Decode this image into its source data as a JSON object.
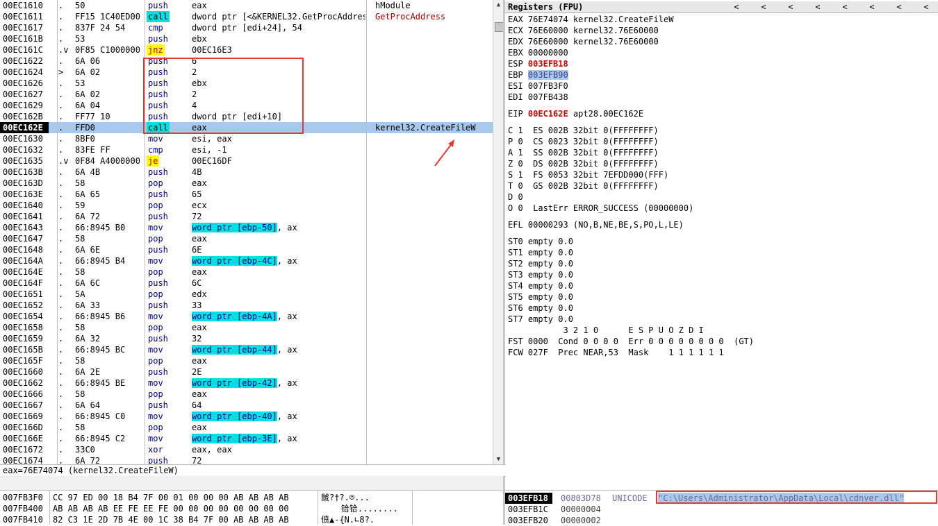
{
  "disasm": {
    "rows": [
      {
        "addr": "00EC1610",
        "mark": ".",
        "bytes": "50",
        "mn": "push",
        "op": "eax",
        "cm": "hModule"
      },
      {
        "addr": "00EC1611",
        "mark": ".",
        "bytes": "FF15 1C40ED00",
        "mn": "call",
        "op": "dword ptr [<&KERNEL32.GetProcAddress>]",
        "cm": "GetProcAddress"
      },
      {
        "addr": "00EC1617",
        "mark": ".",
        "bytes": "837F 24 54",
        "mn": "cmp",
        "op": "dword ptr [edi+24], 54",
        "cm": ""
      },
      {
        "addr": "00EC161B",
        "mark": ".",
        "bytes": "53",
        "mn": "push",
        "op": "ebx",
        "cm": ""
      },
      {
        "addr": "00EC161C",
        "mark": ".v",
        "bytes": "0F85 C1000000",
        "mn": "jnz",
        "op": "00EC16E3",
        "cm": ""
      },
      {
        "addr": "00EC1622",
        "mark": ".",
        "bytes": "6A 06",
        "mn": "push",
        "op": "6",
        "cm": ""
      },
      {
        "addr": "00EC1624",
        "mark": ">",
        "bytes": "6A 02",
        "mn": "push",
        "op": "2",
        "cm": ""
      },
      {
        "addr": "00EC1626",
        "mark": ".",
        "bytes": "53",
        "mn": "push",
        "op": "ebx",
        "cm": ""
      },
      {
        "addr": "00EC1627",
        "mark": ".",
        "bytes": "6A 02",
        "mn": "push",
        "op": "2",
        "cm": ""
      },
      {
        "addr": "00EC1629",
        "mark": ".",
        "bytes": "6A 04",
        "mn": "push",
        "op": "4",
        "cm": ""
      },
      {
        "addr": "00EC162B",
        "mark": ".",
        "bytes": "FF77 10",
        "mn": "push",
        "op": "dword ptr [edi+10]",
        "cm": ""
      },
      {
        "addr": "00EC162E",
        "mark": ".",
        "bytes": "FFD0",
        "mn": "call",
        "op": "eax",
        "cm": "kernel32.CreateFileW"
      },
      {
        "addr": "00EC1630",
        "mark": ".",
        "bytes": "8BF0",
        "mn": "mov",
        "op": "esi, eax",
        "cm": ""
      },
      {
        "addr": "00EC1632",
        "mark": ".",
        "bytes": "83FE FF",
        "mn": "cmp",
        "op": "esi, -1",
        "cm": ""
      },
      {
        "addr": "00EC1635",
        "mark": ".v",
        "bytes": "0F84 A4000000",
        "mn": "je",
        "op": "00EC16DF",
        "cm": ""
      },
      {
        "addr": "00EC163B",
        "mark": ".",
        "bytes": "6A 4B",
        "mn": "push",
        "op": "4B",
        "cm": ""
      },
      {
        "addr": "00EC163D",
        "mark": ".",
        "bytes": "58",
        "mn": "pop",
        "op": "eax",
        "cm": ""
      },
      {
        "addr": "00EC163E",
        "mark": ".",
        "bytes": "6A 65",
        "mn": "push",
        "op": "65",
        "cm": ""
      },
      {
        "addr": "00EC1640",
        "mark": ".",
        "bytes": "59",
        "mn": "pop",
        "op": "ecx",
        "cm": ""
      },
      {
        "addr": "00EC1641",
        "mark": ".",
        "bytes": "6A 72",
        "mn": "push",
        "op": "72",
        "cm": ""
      },
      {
        "addr": "00EC1643",
        "mark": ".",
        "bytes": "66:8945 B0",
        "mn": "mov",
        "op": "word ptr [ebp-50], ax",
        "cm": ""
      },
      {
        "addr": "00EC1647",
        "mark": ".",
        "bytes": "58",
        "mn": "pop",
        "op": "eax",
        "cm": ""
      },
      {
        "addr": "00EC1648",
        "mark": ".",
        "bytes": "6A 6E",
        "mn": "push",
        "op": "6E",
        "cm": ""
      },
      {
        "addr": "00EC164A",
        "mark": ".",
        "bytes": "66:8945 B4",
        "mn": "mov",
        "op": "word ptr [ebp-4C], ax",
        "cm": ""
      },
      {
        "addr": "00EC164E",
        "mark": ".",
        "bytes": "58",
        "mn": "pop",
        "op": "eax",
        "cm": ""
      },
      {
        "addr": "00EC164F",
        "mark": ".",
        "bytes": "6A 6C",
        "mn": "push",
        "op": "6C",
        "cm": ""
      },
      {
        "addr": "00EC1651",
        "mark": ".",
        "bytes": "5A",
        "mn": "pop",
        "op": "edx",
        "cm": ""
      },
      {
        "addr": "00EC1652",
        "mark": ".",
        "bytes": "6A 33",
        "mn": "push",
        "op": "33",
        "cm": ""
      },
      {
        "addr": "00EC1654",
        "mark": ".",
        "bytes": "66:8945 B6",
        "mn": "mov",
        "op": "word ptr [ebp-4A], ax",
        "cm": ""
      },
      {
        "addr": "00EC1658",
        "mark": ".",
        "bytes": "58",
        "mn": "pop",
        "op": "eax",
        "cm": ""
      },
      {
        "addr": "00EC1659",
        "mark": ".",
        "bytes": "6A 32",
        "mn": "push",
        "op": "32",
        "cm": ""
      },
      {
        "addr": "00EC165B",
        "mark": ".",
        "bytes": "66:8945 BC",
        "mn": "mov",
        "op": "word ptr [ebp-44], ax",
        "cm": ""
      },
      {
        "addr": "00EC165F",
        "mark": ".",
        "bytes": "58",
        "mn": "pop",
        "op": "eax",
        "cm": ""
      },
      {
        "addr": "00EC1660",
        "mark": ".",
        "bytes": "6A 2E",
        "mn": "push",
        "op": "2E",
        "cm": ""
      },
      {
        "addr": "00EC1662",
        "mark": ".",
        "bytes": "66:8945 BE",
        "mn": "mov",
        "op": "word ptr [ebp-42], ax",
        "cm": ""
      },
      {
        "addr": "00EC1666",
        "mark": ".",
        "bytes": "58",
        "mn": "pop",
        "op": "eax",
        "cm": ""
      },
      {
        "addr": "00EC1667",
        "mark": ".",
        "bytes": "6A 64",
        "mn": "push",
        "op": "64",
        "cm": ""
      },
      {
        "addr": "00EC1669",
        "mark": ".",
        "bytes": "66:8945 C0",
        "mn": "mov",
        "op": "word ptr [ebp-40], ax",
        "cm": ""
      },
      {
        "addr": "00EC166D",
        "mark": ".",
        "bytes": "58",
        "mn": "pop",
        "op": "eax",
        "cm": ""
      },
      {
        "addr": "00EC166E",
        "mark": ".",
        "bytes": "66:8945 C2",
        "mn": "mov",
        "op": "word ptr [ebp-3E], ax",
        "cm": ""
      },
      {
        "addr": "00EC1672",
        "mark": ".",
        "bytes": "33C0",
        "mn": "xor",
        "op": "eax, eax",
        "cm": ""
      },
      {
        "addr": "00EC1674",
        "mark": ".",
        "bytes": "6A 72",
        "mn": "push",
        "op": "72",
        "cm": ""
      }
    ]
  },
  "registers": {
    "title": "Registers (FPU)",
    "nav": [
      "<",
      "<",
      "<",
      "<",
      "<",
      "<",
      "<",
      "<"
    ],
    "gp": [
      {
        "name": "EAX",
        "val": "76E74074",
        "info": "kernel32.CreateFileW"
      },
      {
        "name": "ECX",
        "val": "76E60000",
        "info": "kernel32.76E60000"
      },
      {
        "name": "EDX",
        "val": "76E60000",
        "info": "kernel32.76E60000"
      },
      {
        "name": "EBX",
        "val": "00000000",
        "info": ""
      },
      {
        "name": "ESP",
        "val": "003EFB18",
        "info": ""
      },
      {
        "name": "EBP",
        "val": "003EFB90",
        "info": ""
      },
      {
        "name": "ESI",
        "val": "007FB3F0",
        "info": ""
      },
      {
        "name": "EDI",
        "val": "007FB438",
        "info": ""
      }
    ],
    "eip": {
      "name": "EIP",
      "val": "00EC162E",
      "info": "apt28.00EC162E"
    },
    "flags": [
      "C 1  ES 002B 32bit 0(FFFFFFFF)",
      "P 0  CS 0023 32bit 0(FFFFFFFF)",
      "A 1  SS 002B 32bit 0(FFFFFFFF)",
      "Z 0  DS 002B 32bit 0(FFFFFFFF)",
      "S 1  FS 0053 32bit 7EFDD000(FFF)",
      "T 0  GS 002B 32bit 0(FFFFFFFF)",
      "D 0",
      "O 0  LastErr ERROR_SUCCESS (00000000)"
    ],
    "efl": "EFL 00000293 (NO,B,NE,BE,S,PO,L,LE)",
    "st": [
      "ST0 empty 0.0",
      "ST1 empty 0.0",
      "ST2 empty 0.0",
      "ST3 empty 0.0",
      "ST4 empty 0.0",
      "ST5 empty 0.0",
      "ST6 empty 0.0",
      "ST7 empty 0.0"
    ],
    "fpu_hdr": "           3 2 1 0      E S P U O Z D I",
    "fst": "FST 0000  Cond 0 0 0 0  Err 0 0 0 0 0 0 0 0  (GT)",
    "fcw": "FCW 027F  Prec NEAR,53  Mask    1 1 1 1 1 1"
  },
  "info_line": "eax=76E74074 (kernel32.CreateFileW)",
  "dump": [
    {
      "addr": "007FB3F0",
      "hex": "CC 97 ED 00 18 B4 7F 00 01 00 00 00 AB AB AB AB",
      "ascii": "虩?†?.☺..."
    },
    {
      "addr": "007FB400",
      "hex": "AB AB AB AB EE FE EE FE 00 00 00 00 00 00 00 00",
      "ascii": "    铪铪........"
    },
    {
      "addr": "007FB410",
      "hex": "82 C3 1E 2D 7B 4E 00 1C 38 B4 7F 00 AB AB AB AB",
      "ascii": "偾▲-{N.∟8?."
    }
  ],
  "stack": [
    {
      "addr": "003EFB18",
      "val": "00803D78",
      "comment": "UNICODE",
      "str": "\"C:\\Users\\Administrator\\AppData\\Local\\cdnver.dll\""
    },
    {
      "addr": "003EFB1C",
      "val": "00000004",
      "comment": "",
      "str": ""
    },
    {
      "addr": "003EFB20",
      "val": "00000002",
      "comment": "",
      "str": ""
    }
  ],
  "colors": {
    "annotation": "#e53935",
    "selection": "#a8c8ec",
    "call_bg": "#00e0e0",
    "jump_bg": "#ffff00"
  }
}
